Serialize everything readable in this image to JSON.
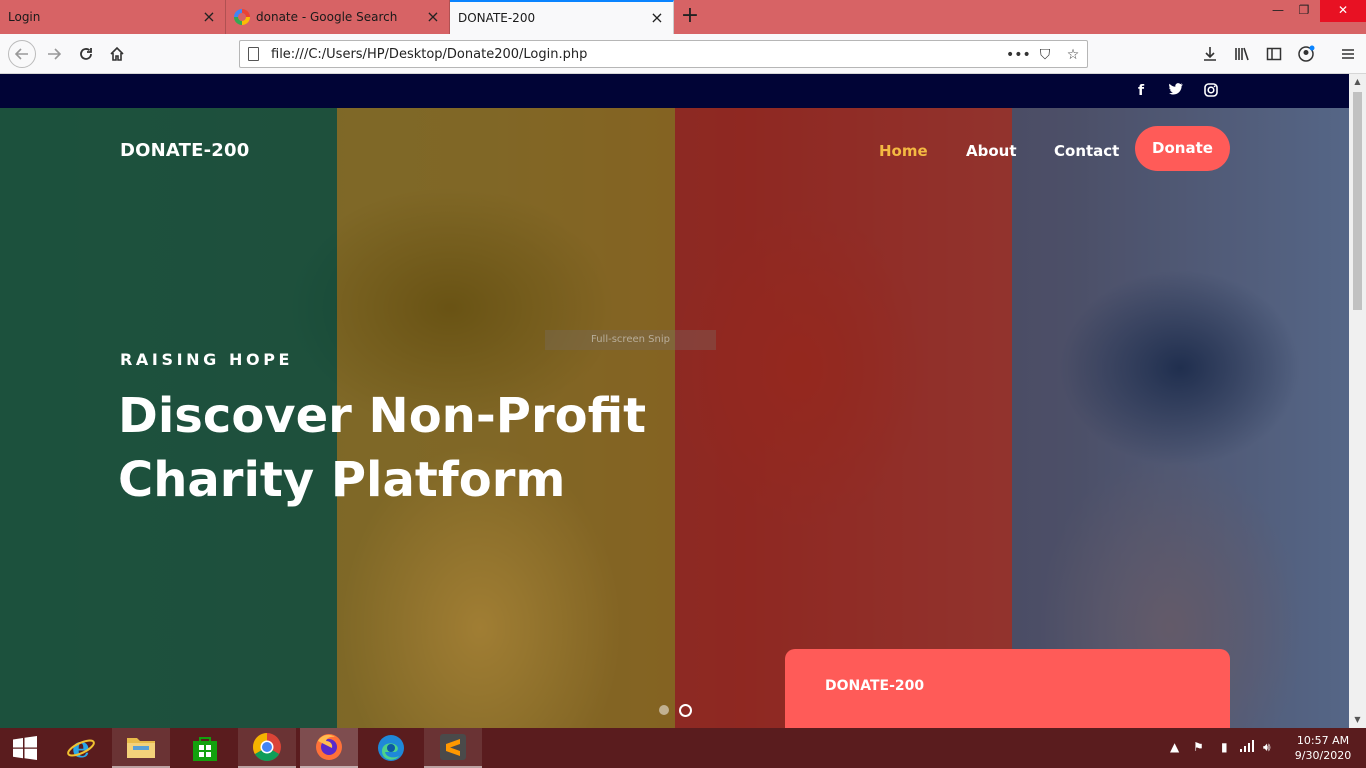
{
  "browser": {
    "tabs": [
      {
        "label": "Login"
      },
      {
        "label": "donate - Google Search"
      },
      {
        "label": "DONATE-200",
        "active": true
      }
    ],
    "url": "file:///C:/Users/HP/Desktop/Donate200/Login.php"
  },
  "site": {
    "brand": "DONATE-200",
    "nav": [
      "Home",
      "About",
      "Contact"
    ],
    "donate_label": "Donate",
    "social": [
      "facebook",
      "twitter",
      "instagram"
    ],
    "hero": {
      "kicker": "RAISING HOPE",
      "headline_line1": "Discover Non-Profit",
      "headline_line2": "Charity Platform",
      "slide_active": 2,
      "slide_count": 2
    },
    "card_title": "DONATE-200",
    "overlay_text": "Full-screen Snip",
    "colors": {
      "accent": "#ff5b58",
      "nav_active": "#f4b942",
      "topstrip": "#010436"
    }
  },
  "taskbar": {
    "apps": [
      "internet-explorer",
      "file-explorer",
      "store",
      "chrome",
      "firefox",
      "edge",
      "sublime-text"
    ],
    "time": "10:57 AM",
    "date": "9/30/2020"
  }
}
